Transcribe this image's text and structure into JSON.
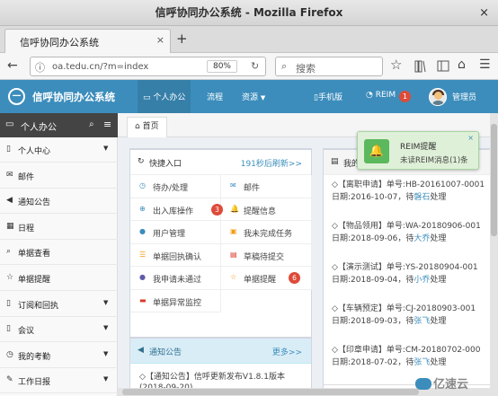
{
  "window": {
    "title": "信呼协同办公系统 - Mozilla Firefox",
    "close_glyph": "×"
  },
  "browser": {
    "tab_title": "信呼协同办公系统",
    "tab_close": "×",
    "new_tab": "+",
    "url": "oa.tedu.cn/?m=index",
    "zoom": "80%",
    "search_placeholder": "搜索"
  },
  "app": {
    "brand": "信呼协同办公系统",
    "nav": [
      "个人办公",
      "流程",
      "资源"
    ],
    "mobile": "手机版",
    "reim": "REIM",
    "reim_count": "1",
    "user": "管理员"
  },
  "sidebar": {
    "title": "个人办公",
    "items": [
      {
        "label": "个人中心",
        "icon": "bookmark-icon",
        "expand": true
      },
      {
        "label": "邮件",
        "icon": "envelope-icon",
        "expand": false
      },
      {
        "label": "通知公告",
        "icon": "volume-icon",
        "expand": false
      },
      {
        "label": "日程",
        "icon": "calendar-icon",
        "expand": false
      },
      {
        "label": "单据查看",
        "icon": "search-icon",
        "expand": false
      },
      {
        "label": "单据提醒",
        "icon": "star-icon",
        "expand": false
      },
      {
        "label": "订阅和回执",
        "icon": "bookmark-icon",
        "expand": true
      },
      {
        "label": "会议",
        "icon": "bookmark-icon",
        "expand": true
      },
      {
        "label": "我的考勤",
        "icon": "clock-icon",
        "expand": true
      },
      {
        "label": "工作日报",
        "icon": "edit-icon",
        "expand": true
      }
    ]
  },
  "breadcrumb": {
    "home": "首页"
  },
  "quick": {
    "title": "快捷入口",
    "refresh": "191秒后刷新>>",
    "items": [
      {
        "label": "待办/处理",
        "icon": "clock-icon",
        "color": "#3c8dbc",
        "badge": ""
      },
      {
        "label": "邮件",
        "icon": "envelope-icon",
        "color": "#3c8dbc",
        "badge": ""
      },
      {
        "label": "出入库操作",
        "icon": "plus-circle-icon",
        "color": "#3c8dbc",
        "badge": "3"
      },
      {
        "label": "提醒信息",
        "icon": "bell-icon",
        "color": "#f39c12",
        "badge": ""
      },
      {
        "label": "用户管理",
        "icon": "user-icon",
        "color": "#3c8dbc",
        "badge": ""
      },
      {
        "label": "我未完成任务",
        "icon": "task-icon",
        "color": "#f39c12",
        "badge": ""
      },
      {
        "label": "单据回执确认",
        "icon": "receipt-icon",
        "color": "#f39c12",
        "badge": ""
      },
      {
        "label": "草稿待提交",
        "icon": "draft-icon",
        "color": "#d73925",
        "badge": ""
      },
      {
        "label": "我申请未通过",
        "icon": "deny-icon",
        "color": "#605ca8",
        "badge": ""
      },
      {
        "label": "单据提醒",
        "icon": "star-icon",
        "color": "#f39c12",
        "badge": "6"
      },
      {
        "label": "单据异常监控",
        "icon": "briefcase-icon",
        "color": "#d73925",
        "badge": ""
      }
    ]
  },
  "notice": {
    "title": "通知公告",
    "more": "更多>>",
    "line": "◇【通知公告】信呼更新发布V1.8.1版本",
    "line2": "(2018-09-20)"
  },
  "mine": {
    "title": "我的",
    "records": [
      {
        "l1": "◇【离职申请】单号:HB-20161007-0001",
        "l2_pre": "日期:2016-10-07，待",
        "user": "磐石",
        "status": "处理"
      },
      {
        "l1": "◇【物品领用】单号:WA-20180906-001",
        "l2_pre": "日期:2018-09-06，待",
        "user": "大乔",
        "status": "处理"
      },
      {
        "l1": "◇【演示测试】单号:YS-20180904-001",
        "l2_pre": "日期:2018-09-04，待",
        "user": "小乔",
        "status": "处理"
      },
      {
        "l1": "◇【车辆预定】单号:CJ-20180903-001",
        "l2_pre": "日期:2018-09-03，待",
        "user": "张飞",
        "status": "处理"
      },
      {
        "l1": "◇【印章申请】单号:CM-20180702-000",
        "l2_pre": "日期:2018-07-02，待",
        "user": "张飞",
        "status": "处理"
      }
    ]
  },
  "popup": {
    "title": "REIM提醒",
    "msg": "未读REIM消息(1)条",
    "close": "×"
  },
  "watermark": "亿速云"
}
